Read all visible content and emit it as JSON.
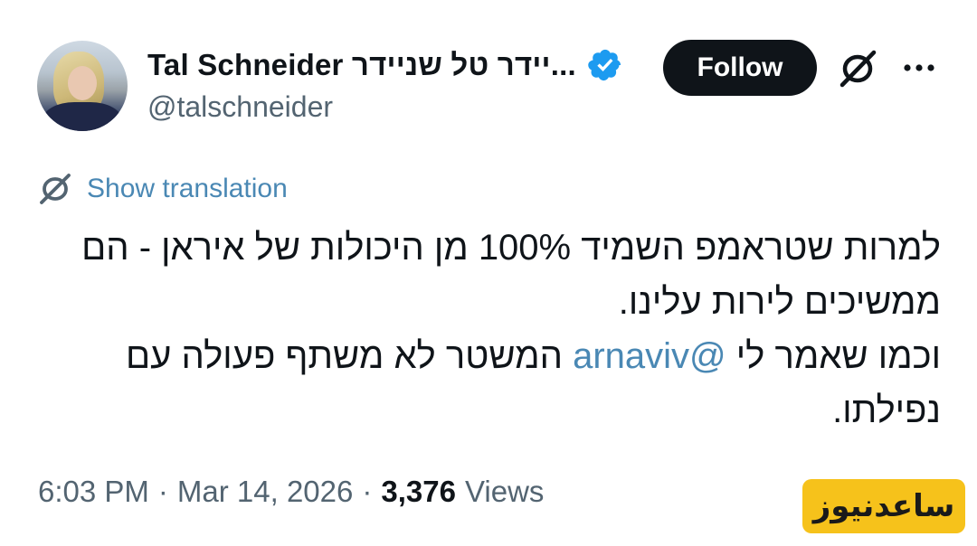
{
  "author": {
    "display_name": "Tal Schneider טל שניידר",
    "display_name_shown": "Tal Schneider יידר טל שניידר...",
    "handle": "@talschneider",
    "verified": true
  },
  "actions": {
    "follow_label": "Follow",
    "grok_icon": "grok-icon",
    "more_icon": "more-icon"
  },
  "translation": {
    "label": "Show translation",
    "icon": "translate-icon"
  },
  "tweet": {
    "line1": "למרות שטראמפ השמיד 100% מן היכולות של איראן - הם",
    "line2": "ממשיכים לירות עלינו.",
    "line3_before": "וכמו שאמר לי ",
    "mention": "@arnaviv",
    "line3_after": " המשטר לא משתף פעולה עם",
    "line4": "נפילתו."
  },
  "meta": {
    "time": "6:03 PM",
    "separator": "·",
    "date": "Mar 14, 2026",
    "views_count": "3,376",
    "views_label": "Views"
  },
  "watermark": {
    "text": "ساعدنیوز"
  },
  "colors": {
    "text_primary": "#0f1419",
    "text_secondary": "#536471",
    "link": "#4a88b4",
    "verified": "#1d9bf0",
    "follow_bg": "#0f1419",
    "watermark_bg": "#f6c21b"
  }
}
